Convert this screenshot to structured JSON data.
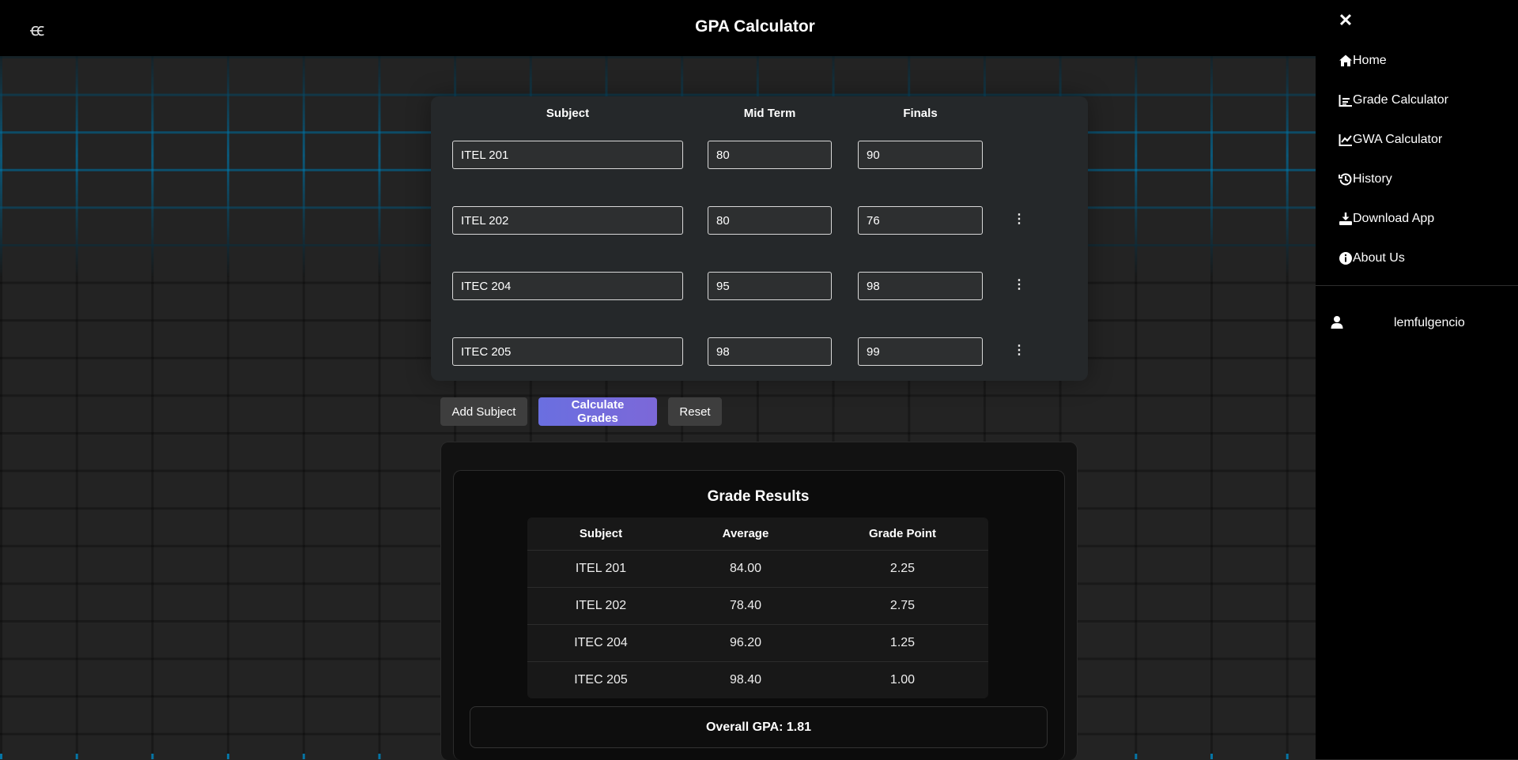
{
  "header": {
    "logo": "ꞓꞓ",
    "title": "GPA Calculator"
  },
  "form": {
    "columns": [
      "Subject",
      "Mid Term",
      "Finals"
    ],
    "rows": [
      {
        "subject": "ITEL 201",
        "midterm": "80",
        "finals": "90",
        "has_menu": false
      },
      {
        "subject": "ITEL 202",
        "midterm": "80",
        "finals": "76",
        "has_menu": true
      },
      {
        "subject": "ITEC 204",
        "midterm": "95",
        "finals": "98",
        "has_menu": true
      },
      {
        "subject": "ITEC 205",
        "midterm": "98",
        "finals": "99",
        "has_menu": true
      }
    ],
    "menu_glyph": "⋮"
  },
  "actions": {
    "add_label": "Add Subject",
    "calculate_label": "Calculate Grades",
    "reset_label": "Reset"
  },
  "results": {
    "title": "Grade Results",
    "headers": [
      "Subject",
      "Average",
      "Grade Point"
    ],
    "rows": [
      [
        "ITEL 201",
        "84.00",
        "2.25"
      ],
      [
        "ITEL 202",
        "78.40",
        "2.75"
      ],
      [
        "ITEC 204",
        "96.20",
        "1.25"
      ],
      [
        "ITEC 205",
        "98.40",
        "1.00"
      ]
    ],
    "overall": "Overall GPA: 1.81"
  },
  "drawer": {
    "close_glyph": "✕",
    "items": [
      {
        "label": "Home",
        "icon": "home-icon"
      },
      {
        "label": "Grade Calculator",
        "icon": "bar-chart-icon"
      },
      {
        "label": "GWA Calculator",
        "icon": "line-chart-icon"
      },
      {
        "label": "History",
        "icon": "history-icon"
      },
      {
        "label": "Download App",
        "icon": "download-icon"
      },
      {
        "label": "About Us",
        "icon": "info-icon"
      }
    ],
    "user": {
      "name": "lemfulgencio",
      "icon": "user-icon"
    }
  },
  "colors": {
    "accent_start": "#6a6fe0",
    "accent_end": "#7c68d8",
    "grid_glow": "#008cc8"
  }
}
